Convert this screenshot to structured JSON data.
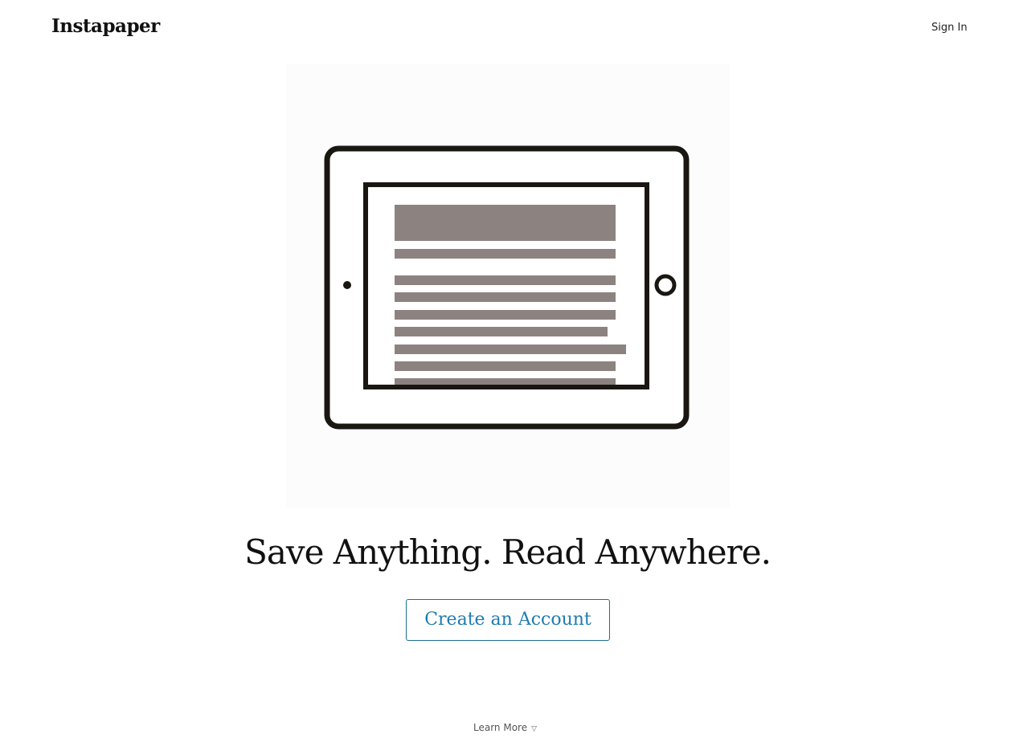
{
  "header": {
    "logo": "Instapaper",
    "sign_in_label": "Sign In"
  },
  "hero": {
    "illustration_icon": "tablet-reading-icon",
    "headline": "Save Anything. Read Anywhere.",
    "cta_label": "Create an Account"
  },
  "footer": {
    "learn_more_label": "Learn More",
    "learn_more_icon": "triangle-down-icon"
  },
  "colors": {
    "accent": "#1f7bb0",
    "text": "#111111",
    "illustration_bars": "#8c8380"
  }
}
